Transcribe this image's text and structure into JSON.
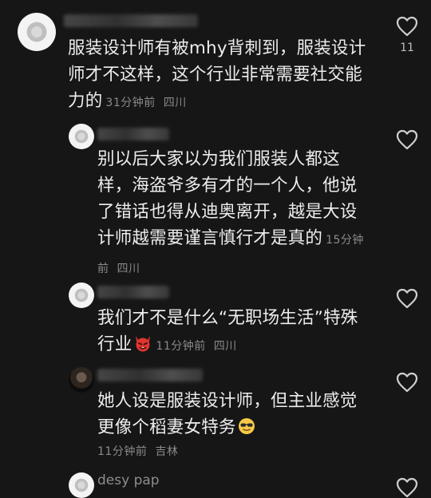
{
  "comments": [
    {
      "text": "服装设计师有被mhy背刺到，服装设计师才不这样，这个行业非常需要社交能力的",
      "time": "31分钟前",
      "location": "四川",
      "likes": "11"
    },
    {
      "text": "别以后大家以为我们服装人都这样，海盗爷多有才的一个人，他说了错话也得从迪奥离开，越是大设计师越需要谨言慎行才是真的",
      "time": "15分钟前",
      "location": "四川"
    },
    {
      "text": "我们才不是什么“无职场生活”特殊行业",
      "emoji": "devil-emoji",
      "time": "11分钟前",
      "location": "四川"
    },
    {
      "text": "她人设是服装设计师，但主业感觉更像个稻妻女特务",
      "emoji": "cool-sunglasses-emoji",
      "time": "11分钟前",
      "location": "吉林"
    },
    {
      "username_partial": "desy pap"
    }
  ],
  "colors": {
    "background": "#161616",
    "text": "#ededed",
    "meta": "#8a8a8a",
    "heart_outline": "#cfcfcf"
  },
  "icons": [
    "heart-outline-icon",
    "devil-emoji",
    "cool-sunglasses-emoji"
  ]
}
